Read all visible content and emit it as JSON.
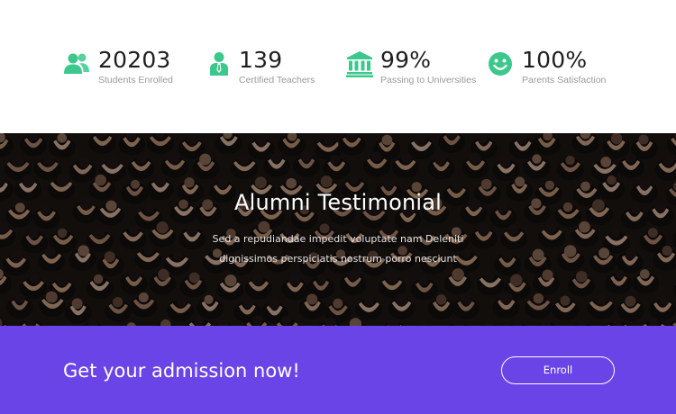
{
  "stats": {
    "accent_color": "#3cc88c",
    "items": [
      {
        "icon": "users-icon",
        "number": "20203",
        "label": "Students Enrolled"
      },
      {
        "icon": "teacher-icon",
        "number": "139",
        "label": "Certified Teachers"
      },
      {
        "icon": "university-icon",
        "number": "99%",
        "label": "Passing to Universities"
      },
      {
        "icon": "smile-icon",
        "number": "100%",
        "label": "Parents Satisfaction"
      }
    ]
  },
  "testimonial": {
    "title": "Alumni Testimonial",
    "text_line_1": "Sed a repudiandae impedit voluptate nam Deleniti",
    "text_line_2": "dignissimos perspiciatis nostrum porro nesciunt",
    "background": "graduation-crowd-photo"
  },
  "admission": {
    "title": "Get your admission now!",
    "button_label": "Enroll",
    "background_color": "#6a44e6"
  }
}
